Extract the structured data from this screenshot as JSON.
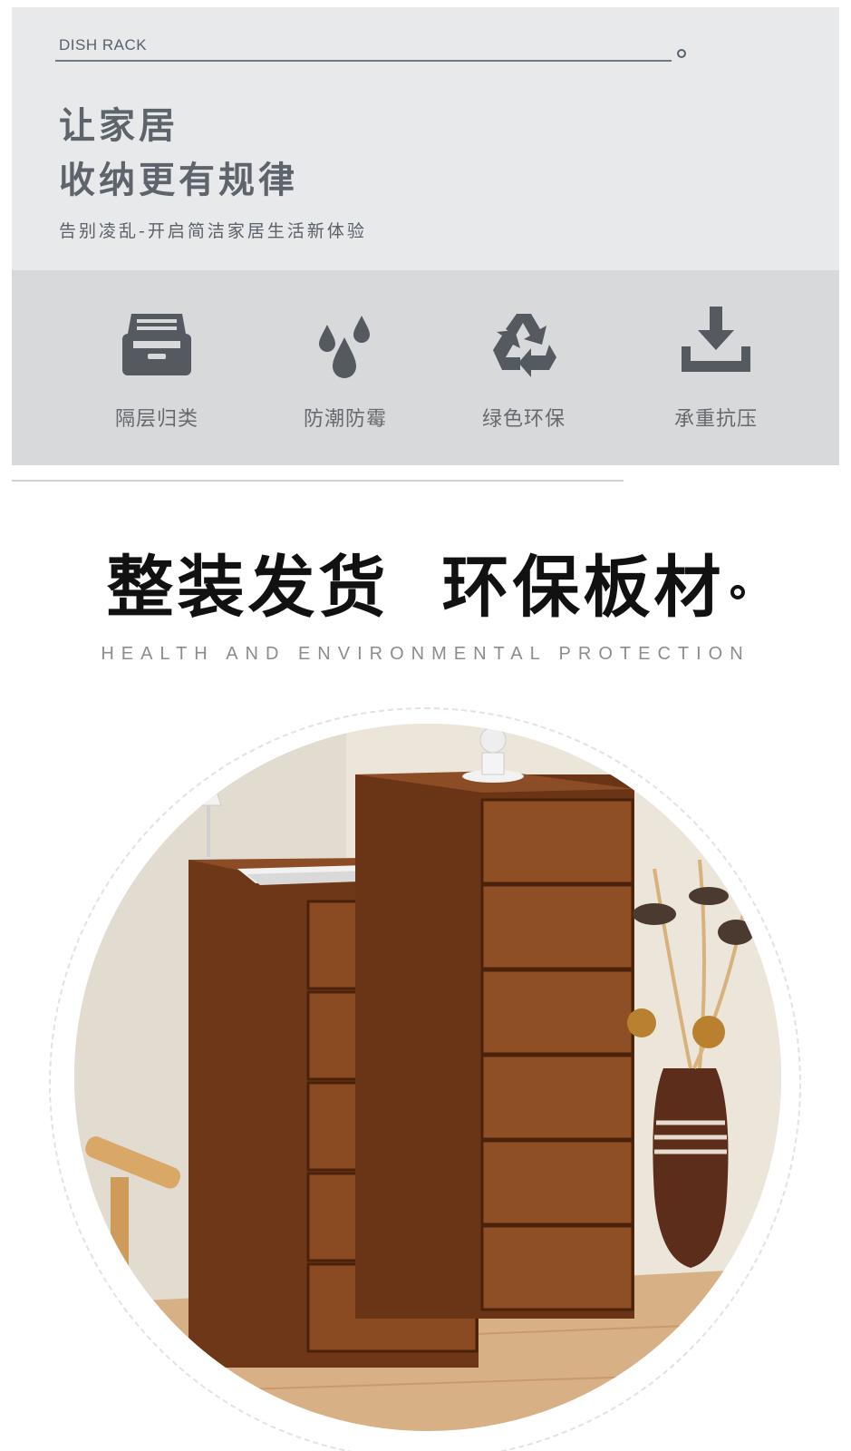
{
  "hero": {
    "tag": "DISH RACK",
    "title_line1": "让家居",
    "title_line2": "收纳更有规律",
    "subtitle": "告别凌乱-开启简洁家居生活新体验"
  },
  "features": [
    {
      "icon": "drawer-icon",
      "label": "隔层归类"
    },
    {
      "icon": "water-drops-icon",
      "label": "防潮防霉"
    },
    {
      "icon": "recycle-icon",
      "label": "绿色环保"
    },
    {
      "icon": "download-tray-icon",
      "label": "承重抗压"
    }
  ],
  "headline": {
    "part1": "整装发货",
    "part2": "环保板材"
  },
  "headline_en": "HEALTH AND ENVIRONMENTAL PROTECTION",
  "photo": {
    "subject": "walnut chest of drawers",
    "colors": {
      "wood": "#7a3f1c",
      "wood_light": "#9a5a2e",
      "wall": "#ece6dc",
      "floor": "#d9b48c"
    }
  }
}
